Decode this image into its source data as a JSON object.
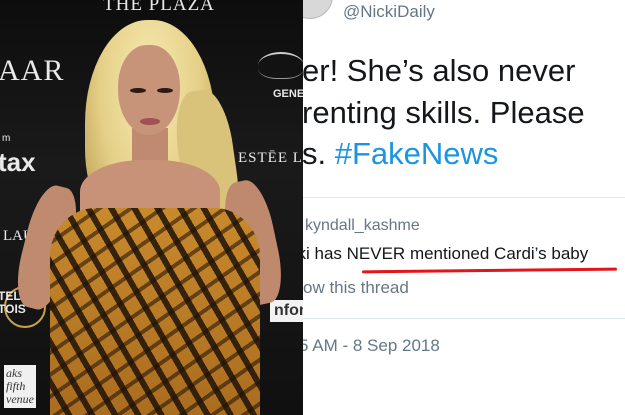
{
  "photo": {
    "backdrop_texts": {
      "top_banner": "THE PLAZA",
      "left_logo": "AAR",
      "left_logo_small": "m",
      "left_brand": "tax",
      "right_brand_top": "GENE",
      "right_brand_mid": "ESTĒE LA",
      "left_lower": "LAU",
      "stella": "TELLA\nTOIS",
      "saks": "aks\nfifth\nvenue",
      "right_lower": "nfor"
    }
  },
  "tweet": {
    "handle": "@NickiDaily",
    "lines": [
      "er! She’s also never",
      "renting skills. Please",
      "s. "
    ],
    "hashtag": "#FakeNews",
    "quoted": {
      "author": "kyndall_kashme",
      "text_prefix": "cki has ",
      "text_emphasis": "NEVER",
      "text_suffix": " mentioned Cardi’s baby"
    },
    "show_thread": "ow this thread",
    "timestamp": "5 AM - 8 Sep 2018"
  },
  "colors": {
    "hashtag": "#1b95e0",
    "underline": "#e0161b",
    "muted_text": "#657786"
  }
}
